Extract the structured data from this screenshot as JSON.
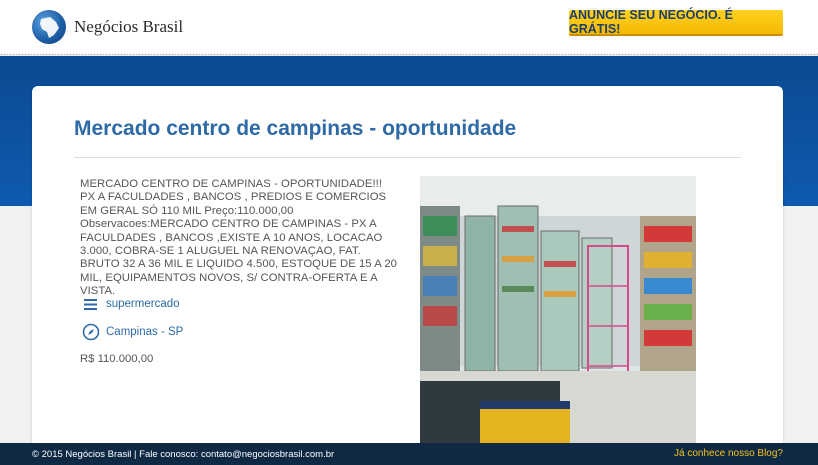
{
  "header": {
    "brand": "Negócios Brasil",
    "cta_label": "ANUNCIE SEU NEGÓCIO. É GRÁTIS!"
  },
  "listing": {
    "title": "Mercado centro de campinas - oportunidade",
    "description": [
      "MERCADO CENTRO DE CAMPINAS - OPORTUNIDADE!!! PX A FACULDADES , BANCOS , PREDIOS E COMERCIOS EM GERAL SÓ 110 MIL Preço:110.000,00",
      "Observacoes:MERCADO CENTRO DE CAMPINAS - PX A FACULDADES , BANCOS ,EXISTE A 10 ANOS, LOCACAO 3.000, COBRA-SE 1 ALUGUEL NA RENOVAÇAO, FAT. BRUTO 32 A 36 MIL E LIQUIDO 4.500, ESTOQUE DE 15 A 20 MIL, EQUIPAMENTOS NOVOS, S/ CONTRA-OFERTA E A VISTA."
    ],
    "category": "supermercado",
    "category_icon": "menu-icon",
    "location": "Campinas - SP",
    "location_icon": "compass-icon",
    "price": "R$ 110.000,00",
    "photo_subject": "photo-icon"
  },
  "footer": {
    "copyright": "© 2015 Negócios Brasil  | Fale conosco: contato@negociosbrasil.com.br",
    "blog_link": "Já conhece nosso Blog?"
  },
  "colors": {
    "brand_blue": "#0e5ab0",
    "title_blue": "#2e6aa6",
    "cta_yellow": "#ffd21f",
    "footer_bg": "#0f2945",
    "footer_link": "#f6c21a"
  }
}
